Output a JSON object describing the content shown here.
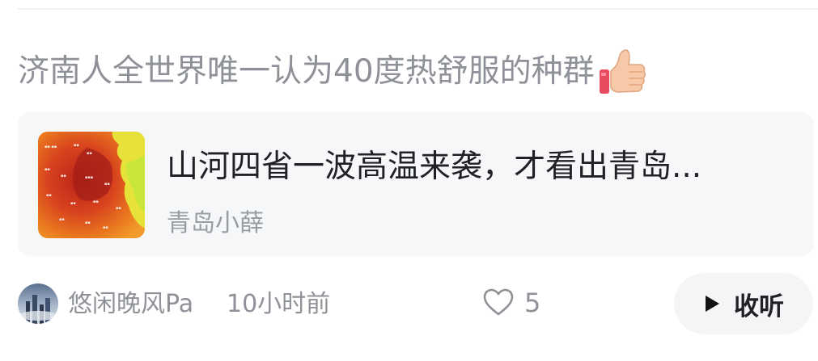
{
  "comment": {
    "text": "济南人全世界唯一认为40度热舒服的种群",
    "emoji_icon": "thumbs-up-icon"
  },
  "card": {
    "title": "山河四省一波高温来袭，才看出青岛...",
    "author": "青岛小薛",
    "thumbnail_icon": "temperature-map-image"
  },
  "footer": {
    "username": "悠闲晚风Pa",
    "time": "10小时前",
    "like_count": "5",
    "listen_label": "收听"
  },
  "colors": {
    "muted_text": "#8e9197",
    "title_text": "#1f2124",
    "card_bg": "#f6f7f9",
    "button_bg": "#f4f5f7"
  }
}
